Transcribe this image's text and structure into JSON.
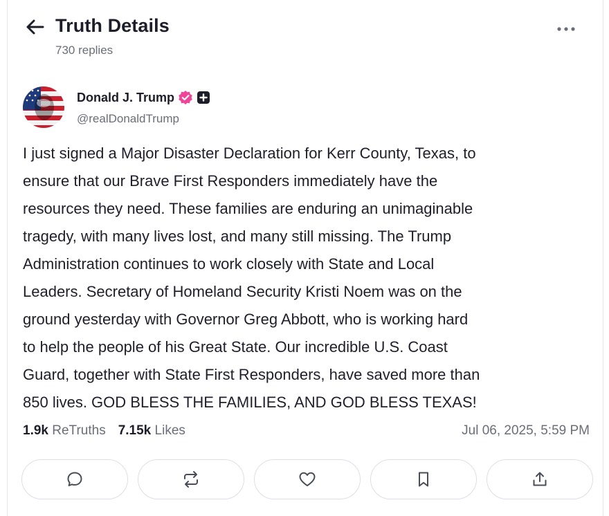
{
  "header": {
    "title": "Truth Details",
    "subtitle": "730 replies",
    "back_icon": "arrow-left-icon",
    "more_icon": "ellipsis-icon"
  },
  "post": {
    "author": {
      "name": "Donald J. Trump",
      "handle": "@realDonaldTrump",
      "verified_icon": "verified-badge-icon",
      "plus_icon": "plus-badge-icon",
      "avatar_icon": "avatar-flag-portrait"
    },
    "text": "I just signed a Major Disaster Declaration for Kerr County, Texas, to\nensure that our Brave First Responders immediately have the\nresources they need. These families are enduring an unimaginable\ntragedy, with many lives lost, and many still missing. The Trump\nAdministration continues to work closely with State and Local\nLeaders. Secretary of Homeland Security Kristi Noem was on the\nground yesterday with Governor Greg Abbott, who is working hard\nto help the people of his Great State. Our incredible U.S. Coast\nGuard, together with State First Responders, have saved more than\n850 lives. GOD BLESS THE FAMILIES, AND GOD BLESS TEXAS!",
    "retruths_count": "1.9k",
    "retruths_label": "ReTruths",
    "likes_count": "7.15k",
    "likes_label": "Likes",
    "timestamp": "Jul 06, 2025, 5:59 PM"
  },
  "actions": [
    {
      "name": "reply-button",
      "icon": "speech-bubble-icon"
    },
    {
      "name": "retruth-button",
      "icon": "repost-icon"
    },
    {
      "name": "like-button",
      "icon": "heart-icon"
    },
    {
      "name": "bookmark-button",
      "icon": "bookmark-icon"
    },
    {
      "name": "share-button",
      "icon": "share-icon"
    }
  ],
  "colors": {
    "verified": "#f0449a",
    "text": "#1f1f2b",
    "muted": "#6b6e78",
    "border": "#dcdfe5"
  }
}
